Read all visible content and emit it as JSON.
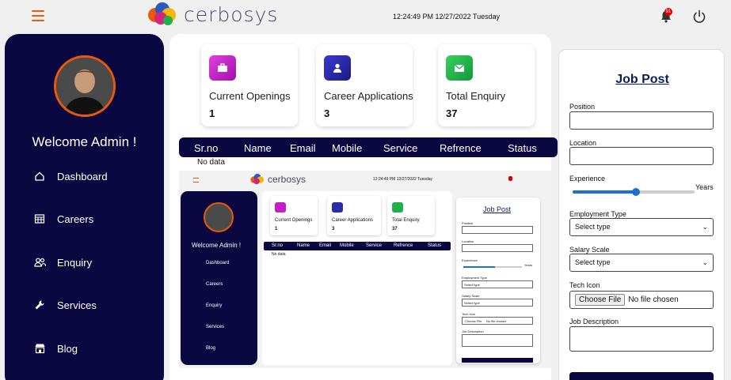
{
  "header": {
    "brand": "cerbosys",
    "datetime": "12:24:49 PM  12/27/2022  Tuesday",
    "notification_count": "91"
  },
  "sidebar": {
    "welcome": "Welcome Admin !",
    "items": [
      {
        "label": "Dashboard",
        "icon": "home-icon"
      },
      {
        "label": "Careers",
        "icon": "calendar-icon"
      },
      {
        "label": "Enquiry",
        "icon": "users-icon"
      },
      {
        "label": "Services",
        "icon": "wrench-icon"
      },
      {
        "label": "Blog",
        "icon": "store-icon"
      }
    ]
  },
  "stats": [
    {
      "label": "Current Openings",
      "value": "1",
      "color": "#c41fc4",
      "icon": "briefcase-icon"
    },
    {
      "label": "Career Applications",
      "value": "3",
      "color": "#2b2ba8",
      "icon": "person-icon"
    },
    {
      "label": "Total Enquiry",
      "value": "37",
      "color": "#1fb04a",
      "icon": "mail-icon"
    }
  ],
  "table": {
    "columns": [
      "Sr.no",
      "Name",
      "Email",
      "Mobile",
      "Service",
      "Refrence",
      "Status"
    ],
    "empty_text": "No data"
  },
  "mini": {
    "datetime": "12:24:49 PM  12/27/2022  Tuesday",
    "welcome": "Welcome Admin !",
    "nav": [
      "Dashboard",
      "Careers",
      "Enquiry",
      "Services",
      "Blog"
    ],
    "stats": [
      "Current Openings",
      "Career Applications",
      "Total Enquiry"
    ],
    "values": [
      "1",
      "3",
      "37"
    ],
    "columns": [
      "Sr.no",
      "Name",
      "Email",
      "Mobile",
      "Service",
      "Refrence",
      "Status"
    ],
    "nodata": "No data",
    "form_title": "Job Post",
    "labels": [
      "Position",
      "Location",
      "Experience",
      "Employment Type",
      "Salary Scale",
      "Tech Icon",
      "Job Description"
    ],
    "years": "Years",
    "select": "Select type",
    "choose": "Choose File",
    "nofile": "No file chosen"
  },
  "form": {
    "title": "Job Post",
    "position_label": "Position",
    "location_label": "Location",
    "experience_label": "Experience",
    "experience_unit": "Years",
    "experience_level": 0.52,
    "employment_label": "Employment Type",
    "employment_value": "Select type",
    "salary_label": "Salary Scale",
    "salary_value": "Select type",
    "tech_icon_label": "Tech Icon",
    "choose_file": "Choose File",
    "no_file": "No file chosen",
    "description_label": "Job Description"
  }
}
